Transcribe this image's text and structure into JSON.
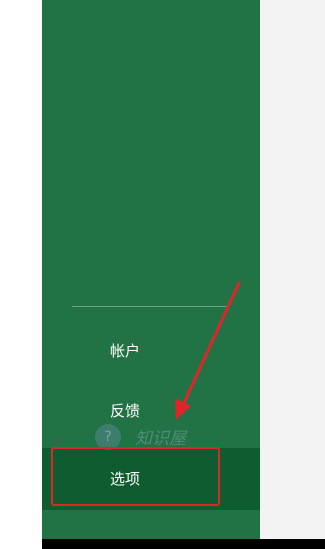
{
  "sidebar": {
    "items": [
      {
        "label": "帐户"
      },
      {
        "label": "反馈"
      },
      {
        "label": "选项",
        "selected": true
      }
    ]
  },
  "watermark": {
    "text": "知识屋",
    "icon": "question-icon"
  },
  "colors": {
    "sidebar": "#217346",
    "selected": "#0e5c2f",
    "annotation": "#e0252a",
    "content": "#f3f3f3"
  }
}
